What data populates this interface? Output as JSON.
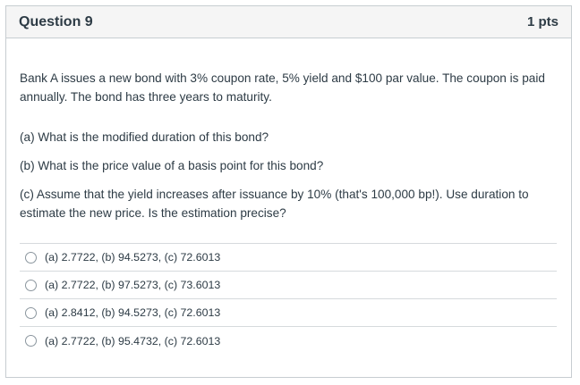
{
  "question": {
    "title": "Question 9",
    "points": "1 pts",
    "paragraphs": {
      "main": "Bank A issues a new bond with 3% coupon rate, 5% yield and $100 par value. The coupon is paid annually. The bond has three years to maturity.",
      "part_a": "(a) What is the modified duration of this bond?",
      "part_b": "(b) What is the price value of a basis point for this bond?",
      "part_c": "(c) Assume that the yield increases after issuance by 10% (that's 100,000 bp!). Use duration to estimate the new price. Is the estimation precise?"
    },
    "answers": [
      {
        "label": "(a) 2.7722, (b) 94.5273, (c) 72.6013",
        "selected": false
      },
      {
        "label": "(a) 2.7722, (b) 97.5273, (c) 73.6013",
        "selected": false
      },
      {
        "label": "(a) 2.8412, (b) 94.5273, (c) 72.6013",
        "selected": false
      },
      {
        "label": "(a) 2.7722, (b) 95.4732, (c) 72.6013",
        "selected": false
      }
    ]
  },
  "colors": {
    "text": "#2d3b45",
    "header_bg": "#f5f5f5",
    "border": "#c7cdd1",
    "divider": "#d6dadd",
    "radio_border": "#8b969e"
  }
}
